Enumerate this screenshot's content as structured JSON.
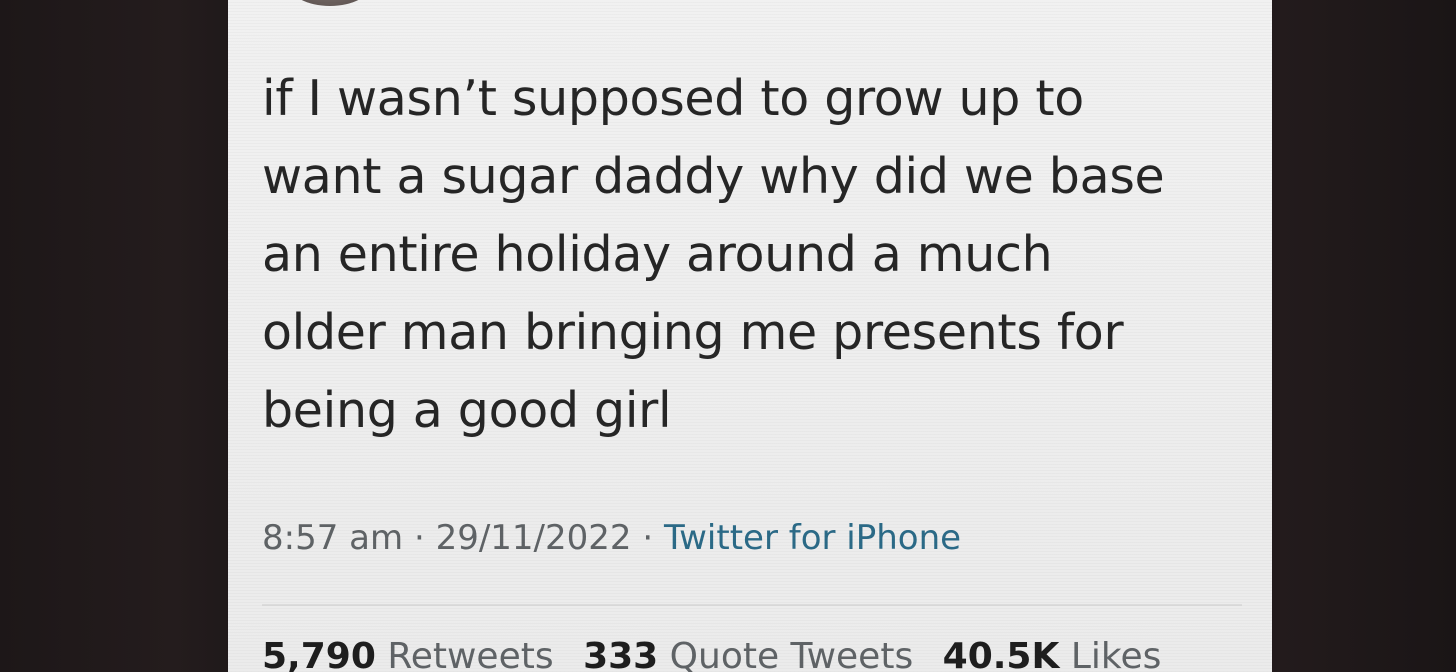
{
  "tweet": {
    "lines": [
      "if I wasn’t supposed to grow up to",
      "want a sugar daddy why did we base",
      "an entire holiday around a much",
      "older man bringing me presents for",
      "being a good girl"
    ],
    "time": "8:57 am",
    "date": "29/11/2022",
    "separator": "·",
    "source": "Twitter for iPhone"
  },
  "stats": {
    "retweets_count": "5,790",
    "retweets_label": "Retweets",
    "quotes_count": "333",
    "quotes_label": "Quote Tweets",
    "likes_count": "40.5K",
    "likes_label": "Likes"
  },
  "colors": {
    "text": "#262626",
    "muted": "#5f6366",
    "link": "#2b6a87",
    "background": "#eeeeee"
  },
  "icons": [
    "avatar"
  ]
}
